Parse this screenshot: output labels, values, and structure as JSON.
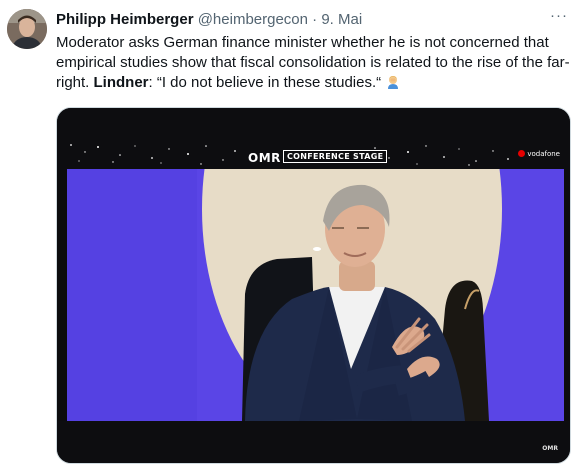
{
  "author": {
    "display_name": "Philipp Heimberger",
    "handle": "@heimbergecon",
    "separator": "·",
    "date": "9. Mai"
  },
  "more_label": "···",
  "tweet": {
    "text_part1": "Moderator asks German finance minister whether he is not concerned that empirical studies show that fiscal consolidation is related to the rise of the far-right. ",
    "speaker": "Lindner",
    "text_part2": ": “I do not believe in these studies.“"
  },
  "icons": {
    "emoji": "man-facepalming-icon",
    "more": "more-options-icon",
    "avatar": "avatar"
  },
  "video": {
    "logo": "OMR",
    "stage_label": "CONFERENCE STAGE",
    "sponsor": "vodafone",
    "corner_logo": "OMR"
  },
  "colors": {
    "text": "#0f1419",
    "secondary": "#536471",
    "stage_purple": "#5a45e6",
    "stage_cream": "#e7dcc7"
  }
}
